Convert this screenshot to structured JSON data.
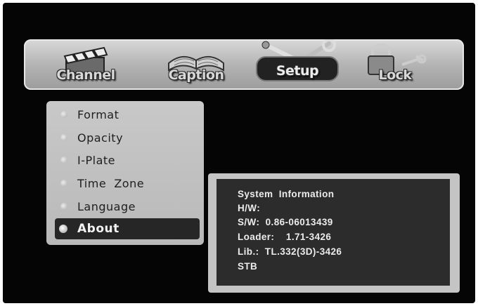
{
  "tabs": [
    {
      "label": "Channel",
      "icon": "clapperboard-icon",
      "active": false
    },
    {
      "label": "Caption",
      "icon": "book-icon",
      "active": false
    },
    {
      "label": "Setup",
      "icon": "tools-icon",
      "active": true
    },
    {
      "label": "Lock",
      "icon": "padlock-icon",
      "active": false
    }
  ],
  "menu": {
    "items": [
      {
        "label": "Format"
      },
      {
        "label": "Opacity"
      },
      {
        "label": "I-Plate"
      },
      {
        "label": "Time  Zone"
      },
      {
        "label": "Language"
      },
      {
        "label": "About",
        "selected": true
      }
    ]
  },
  "info": {
    "title": "System  Information",
    "hw": "H/W:",
    "sw": "S/W:  0.86-06013439",
    "loader": "Loader:    1.71-3426",
    "lib": "Lib.:  TL.332(3D)-3426",
    "stb": "STB"
  }
}
